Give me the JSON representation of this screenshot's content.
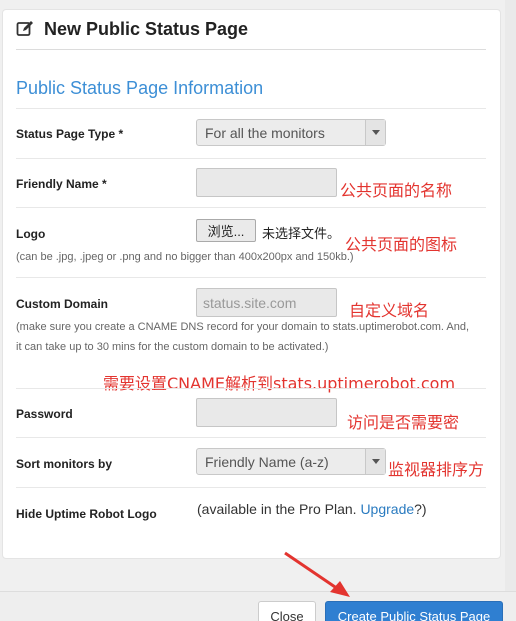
{
  "header": {
    "title": "New Public Status Page"
  },
  "section_title": "Public Status Page Information",
  "fields": {
    "status_type": {
      "label": "Status Page Type *",
      "value": "For all the monitors"
    },
    "friendly_name": {
      "label": "Friendly Name *",
      "value": ""
    },
    "logo": {
      "label": "Logo",
      "browse_label": "浏览...",
      "no_file_text": "未选择文件。",
      "help": "(can be .jpg, .jpeg or .png and no bigger than 400x200px and 150kb.)"
    },
    "custom_domain": {
      "label": "Custom Domain",
      "placeholder": "status.site.com",
      "help": "(make sure you create a CNAME DNS record for your domain to stats.uptimerobot.com. And, it can take up to 30 mins for the custom domain to be activated.)"
    },
    "password": {
      "label": "Password",
      "value": ""
    },
    "sort": {
      "label": "Sort monitors by",
      "value": "Friendly Name (a-z)"
    },
    "hide_logo": {
      "label": "Hide Uptime Robot Logo",
      "text_before": "(available in the Pro Plan. ",
      "link": "Upgrade",
      "text_after": "?)"
    }
  },
  "annotations": {
    "friendly_name": "公共页面的名称",
    "logo": "公共页面的图标",
    "custom_domain": "自定义域名",
    "cname": "需要设置CNAME解析到stats.uptimerobot.com",
    "password": "访问是否需要密",
    "sort": "监视器排序方"
  },
  "footer": {
    "close_label": "Close",
    "create_label": "Create Public Status Page"
  },
  "colors": {
    "accent": "#3d8fd6",
    "primary_button": "#2f7fd1",
    "annotation": "#e3342f"
  },
  "icons": {
    "header": "edit-icon"
  }
}
